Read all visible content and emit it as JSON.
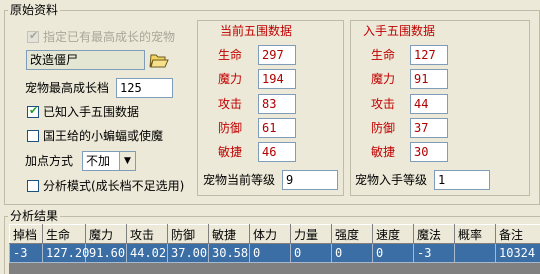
{
  "original": {
    "title": "原始资料",
    "preset_checkbox_label": "指定已有最高成长的宠物",
    "pet_name": "改造僵尸",
    "max_growth_label": "宠物最高成长档",
    "max_growth_value": "125",
    "known_stats_label": "已知入手五围数据",
    "king_bat_label": "国王给的小蝙蝠或使魔",
    "add_mode_label": "加点方式",
    "add_mode_value": "不加",
    "analysis_mode_label": "分析模式(成长档不足选用)"
  },
  "current_stats": {
    "title": "当前五围数据",
    "rows": [
      {
        "label": "生命",
        "value": "297"
      },
      {
        "label": "魔力",
        "value": "194"
      },
      {
        "label": "攻击",
        "value": "83"
      },
      {
        "label": "防御",
        "value": "61"
      },
      {
        "label": "敏捷",
        "value": "46"
      }
    ],
    "level_label": "宠物当前等级",
    "level_value": "9"
  },
  "initial_stats": {
    "title": "入手五围数据",
    "rows": [
      {
        "label": "生命",
        "value": "127"
      },
      {
        "label": "魔力",
        "value": "91"
      },
      {
        "label": "攻击",
        "value": "44"
      },
      {
        "label": "防御",
        "value": "37"
      },
      {
        "label": "敏捷",
        "value": "30"
      }
    ],
    "level_label": "宠物入手等级",
    "level_value": "1"
  },
  "results": {
    "title": "分析结果",
    "columns": [
      "掉档",
      "生命",
      "魔力",
      "攻击",
      "防御",
      "敏捷",
      "体力",
      "力量",
      "强度",
      "速度",
      "魔法",
      "概率",
      "备注"
    ],
    "rows": [
      [
        "-3",
        "127.20",
        "91.60",
        "44.02",
        "37.00",
        "30.58",
        "0",
        "0",
        "0",
        "0",
        "-3",
        "",
        "10324"
      ]
    ]
  },
  "colors": {
    "window_bg": "#ece9d8",
    "stat_label": "#c00000",
    "selected_row": "#3a6ea5",
    "check_mark": "#21a121"
  },
  "icons": {
    "open_folder": "folder-open-icon",
    "dropdown": "chevron-down-icon",
    "check": "check-icon"
  }
}
